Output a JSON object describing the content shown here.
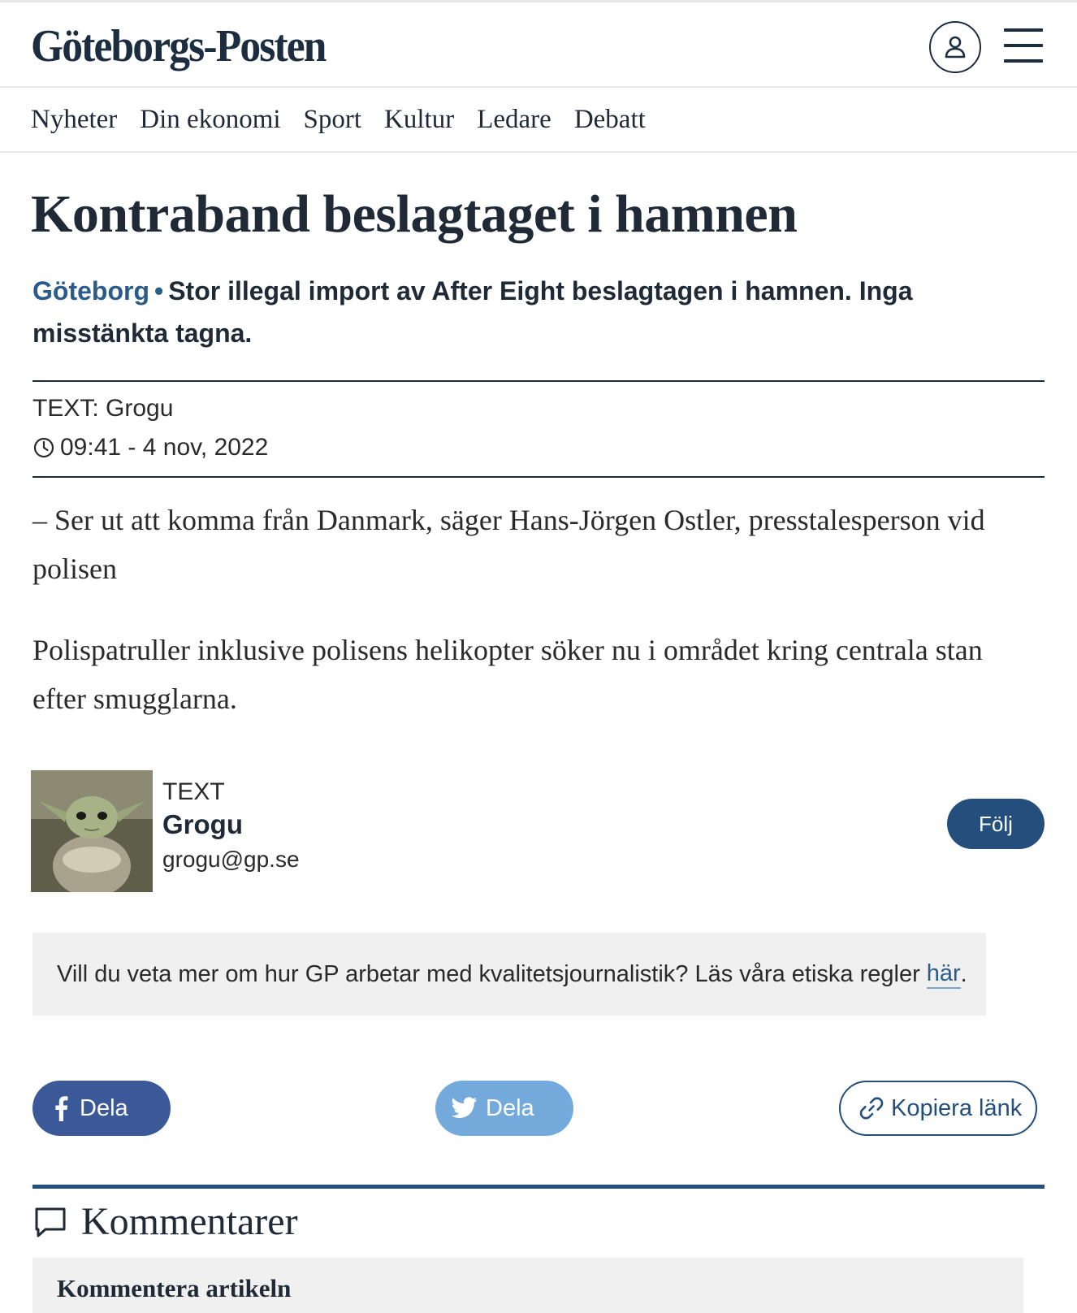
{
  "header": {
    "logo": "Göteborgs-Posten",
    "icons": {
      "user": "user-icon",
      "menu": "hamburger-menu-icon"
    }
  },
  "nav": {
    "items": [
      "Nyheter",
      "Din ekonomi",
      "Sport",
      "Kultur",
      "Ledare",
      "Debatt"
    ]
  },
  "article": {
    "headline": "Kontraband beslagtaget i hamnen",
    "location": "Göteborg",
    "separator": "•",
    "lead": "Stor illegal import av After Eight beslagtagen i hamnen. Inga misstänkta tagna.",
    "byline": "TEXT: Grogu",
    "published": "09:41 - 4 nov, 2022",
    "paragraphs": [
      "– Ser ut att komma från Danmark, säger Hans-Jörgen Ostler, presstalesperson vid polisen",
      "Polispatruller inklusive polisens helikopter söker nu i området kring centrala stan efter smugglarna."
    ]
  },
  "author": {
    "role": "TEXT",
    "name": "Grogu",
    "email": "grogu@gp.se",
    "follow_label": "Följ"
  },
  "ethics": {
    "text": "Vill du veta mer om hur GP arbetar med kvalitetsjournalistik? Läs våra etiska regler",
    "link_label": "här",
    "end": "."
  },
  "share": {
    "facebook_label": "Dela",
    "twitter_label": "Dela",
    "copy_label": "Kopiera länk"
  },
  "comments": {
    "title": "Kommentarer",
    "input_label": "Kommentera artikeln"
  },
  "colors": {
    "brand_navy": "#1c2d3f",
    "link_blue": "#2b5b8a",
    "follow_blue": "#244f7c",
    "facebook": "#3b5998",
    "twitter": "#74a9db"
  }
}
